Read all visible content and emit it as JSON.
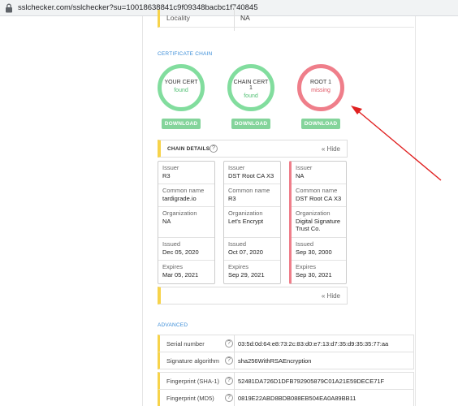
{
  "browser": {
    "url": "sslchecker.com/sslchecker?su=10018638841c9f09348bacbc1f740845",
    "lock_icon": "lock-icon"
  },
  "locality": {
    "label": "Locality",
    "value": "NA"
  },
  "certificate_chain": {
    "title": "CERTIFICATE CHAIN",
    "items": [
      {
        "name": "YOUR CERT",
        "status": "found",
        "download": "DOWNLOAD"
      },
      {
        "name": "CHAIN CERT 1",
        "status": "found",
        "download": "DOWNLOAD"
      },
      {
        "name": "ROOT 1",
        "status": "missing",
        "download": "DOWNLOAD"
      }
    ]
  },
  "chain_details": {
    "label": "CHAIN DETAILS",
    "help": "?",
    "hide_label": "« Hide",
    "columns": [
      {
        "issuer_label": "Issuer",
        "issuer": "R3",
        "common_name_label": "Common name",
        "common_name": "tardigrade.io",
        "organization_label": "Organization",
        "organization": "NA",
        "issued_label": "Issued",
        "issued": "Dec 05, 2020",
        "expires_label": "Expires",
        "expires": "Mar 05, 2021"
      },
      {
        "issuer_label": "Issuer",
        "issuer": "DST Root CA X3",
        "common_name_label": "Common name",
        "common_name": "R3",
        "organization_label": "Organization",
        "organization": "Let's Encrypt",
        "issued_label": "Issued",
        "issued": "Oct 07, 2020",
        "expires_label": "Expires",
        "expires": "Sep 29, 2021"
      },
      {
        "issuer_label": "Issuer",
        "issuer": "NA",
        "common_name_label": "Common name",
        "common_name": "DST Root CA X3",
        "organization_label": "Organization",
        "organization": "Digital Signature Trust Co.",
        "issued_label": "Issued",
        "issued": "Sep 30, 2000",
        "expires_label": "Expires",
        "expires": "Sep 30, 2021"
      }
    ]
  },
  "advanced": {
    "title": "ADVANCED",
    "rows": [
      {
        "label": "Serial number",
        "help": "?",
        "value": "03:5d:0d:64:e8:73:2c:83:d0:e7:13:d7:35:d9:35:35:77:aa"
      },
      {
        "label": "Signature algorithm",
        "help": "?",
        "value": "sha256WithRSAEncryption"
      },
      {
        "label": "Fingerprint (SHA-1)",
        "help": "?",
        "value": "52481DA726D1DFB792905879C01A21E59DECE71F"
      },
      {
        "label": "Fingerprint (MD5)",
        "help": "?",
        "value": "0819E22ABD8BDB088EB504EA0A89BB11"
      }
    ]
  },
  "colors": {
    "found_ring": "#82dd9e",
    "missing_ring": "#ef7e8a",
    "download_button": "#84d49b",
    "section_title": "#3b8dd8",
    "accent_bar": "#f7d34a",
    "arrow": "#e02020"
  }
}
